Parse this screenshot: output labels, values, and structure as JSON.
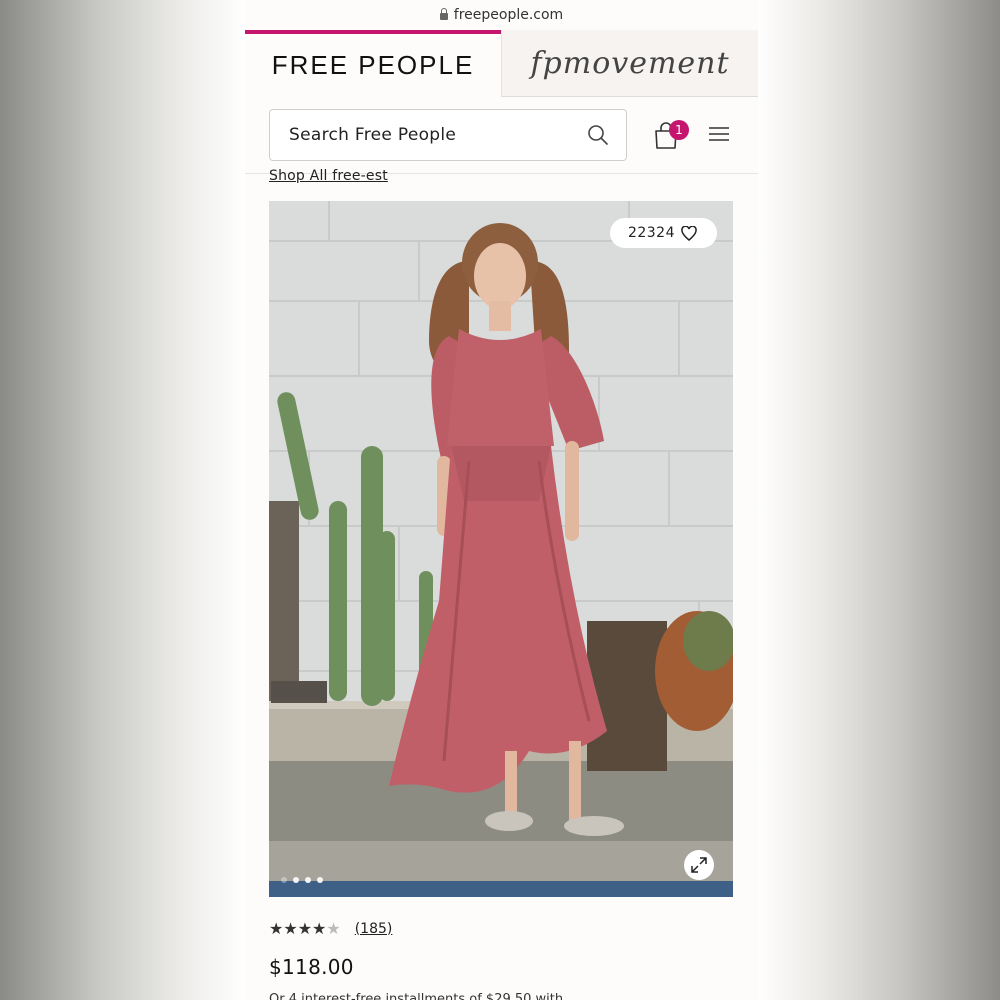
{
  "browser": {
    "url": "freepeople.com"
  },
  "brand_tabs": {
    "primary": "FREE PEOPLE",
    "secondary": "fpmovement"
  },
  "header": {
    "search_placeholder": "Search Free People",
    "cart_count": "1"
  },
  "promo": {
    "link": "Shop All free-est"
  },
  "product": {
    "wishlist_count": "22324",
    "rating": 4.5,
    "stars": "★★★★",
    "review_count": "(185)",
    "price": "$118.00",
    "installments_text": "Or 4 interest-free installments of $29.50 with"
  },
  "gallery": {
    "dots": 4
  },
  "colors": {
    "accent": "#c4166f",
    "dress": "#c05a62"
  }
}
